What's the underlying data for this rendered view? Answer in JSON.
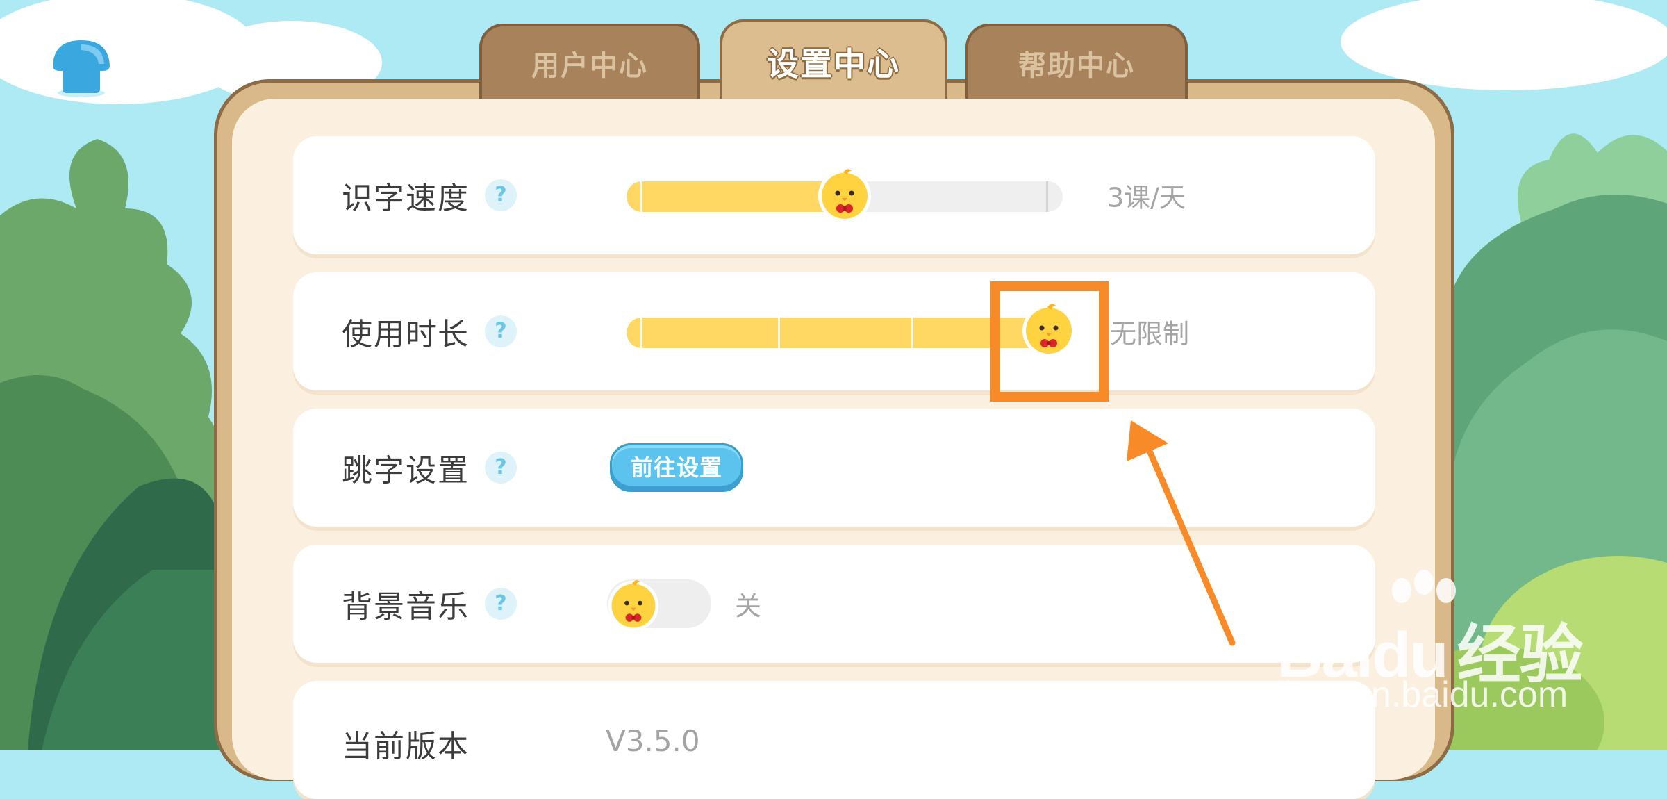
{
  "tabs": [
    {
      "label": "用户中心",
      "active": false
    },
    {
      "label": "设置中心",
      "active": true
    },
    {
      "label": "帮助中心",
      "active": false
    }
  ],
  "settings": {
    "speed": {
      "label": "识字速度",
      "help": "?",
      "value": "3课/天",
      "level": 0.5
    },
    "duration": {
      "label": "使用时长",
      "help": "?",
      "value": "无限制",
      "level": 1.0
    },
    "skip": {
      "label": "跳字设置",
      "help": "?",
      "button_label": "前往设置"
    },
    "music": {
      "label": "背景音乐",
      "help": "?",
      "state": "关",
      "on": false
    },
    "version": {
      "label": "当前版本",
      "value": "V3.5.0"
    }
  },
  "watermark": {
    "brand_prefix": "Bai",
    "brand_suffix": "du",
    "brand_cn": "经验",
    "url": "jingyan.baidu.com"
  },
  "colors": {
    "accent_yellow": "#fed862",
    "accent_blue": "#5cc3ee",
    "highlight": "#f98a28",
    "panel": "#d9b98a"
  }
}
